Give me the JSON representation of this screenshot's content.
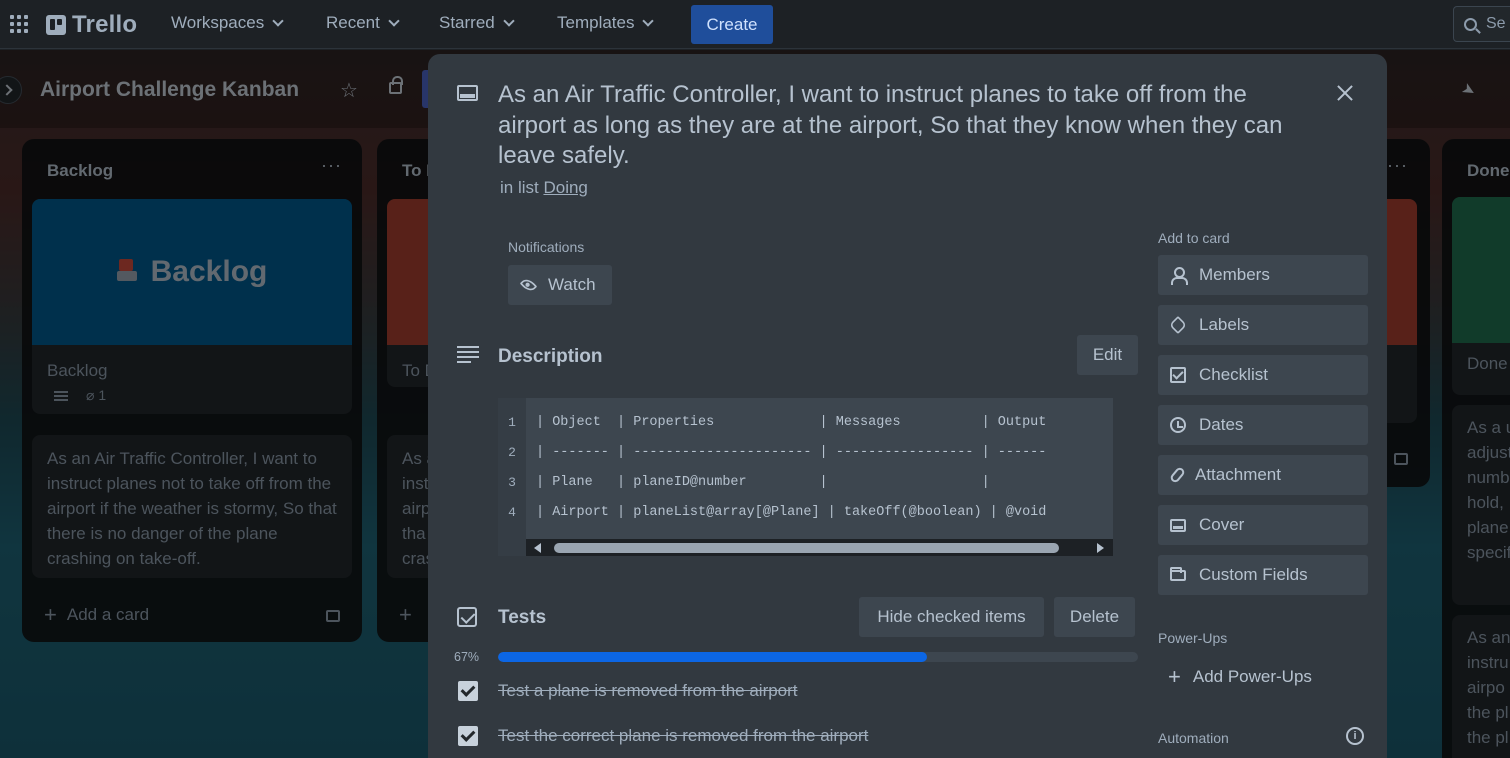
{
  "topnav": {
    "logo_text": "Trello",
    "menus": [
      "Workspaces",
      "Recent",
      "Starred",
      "Templates"
    ],
    "create_label": "Create",
    "search_placeholder": "Se"
  },
  "board": {
    "title": "Airport Challenge Kanban",
    "lists": [
      {
        "title": "Backlog",
        "cover_text": "Backlog",
        "card_title": "Backlog",
        "attachments": "1",
        "card2_text": "As an Air Traffic Controller, I want to instruct planes not to take off from the airport if the weather is stormy, So that there is no danger of the plane crashing on take-off.",
        "add_card": "Add a card"
      },
      {
        "title": "To D",
        "card_title": "To D",
        "card2_text": "As a\ninst\nairp\ntha\ncras",
        "add_card": "A"
      },
      {
        "title": "Done",
        "card_title": "Done",
        "card2_text": "As a u\nadjust\nnumb\nhold,\nplane\nspecif",
        "card3_text": "As an\ninstru\nairpo\nthe pl\nthe pl"
      }
    ]
  },
  "modal": {
    "title": "As an Air Traffic Controller, I want to instruct planes to take off from the airport as long as they are at the airport, So that they know when they can leave safely.",
    "in_list_prefix": "in list",
    "in_list_link": "Doing",
    "notifications_label": "Notifications",
    "watch_label": "Watch",
    "description_title": "Description",
    "edit_label": "Edit",
    "code_lines": [
      {
        "n": "1",
        "text": "| Object  | Properties             | Messages          | Output"
      },
      {
        "n": "2",
        "text": "| ------- | ---------------------- | ----------------- | ------"
      },
      {
        "n": "3",
        "text": "| Plane   | planeID@number         |                   |"
      },
      {
        "n": "4",
        "text": "| Airport | planeList@array[@Plane] | takeOff(@boolean) | @void"
      }
    ],
    "checklist": {
      "title": "Tests",
      "hide_label": "Hide checked items",
      "delete_label": "Delete",
      "percent_text": "67%",
      "progress": 0.67,
      "items": [
        {
          "text": "Test a plane is removed from the airport",
          "checked": true
        },
        {
          "text": "Test the correct plane is removed from the airport",
          "checked": true
        }
      ]
    },
    "sidebar": {
      "add_to_card_label": "Add to card",
      "buttons": [
        {
          "label": "Members",
          "icon": "person-icon"
        },
        {
          "label": "Labels",
          "icon": "tag-icon"
        },
        {
          "label": "Checklist",
          "icon": "checklist-icon"
        },
        {
          "label": "Dates",
          "icon": "clock-icon"
        },
        {
          "label": "Attachment",
          "icon": "paperclip-icon"
        },
        {
          "label": "Cover",
          "icon": "cover-icon"
        },
        {
          "label": "Custom Fields",
          "icon": "custom-fields-icon"
        }
      ],
      "powerups_label": "Power-Ups",
      "add_powerups_label": "Add Power-Ups",
      "automation_label": "Automation"
    }
  },
  "colors": {
    "modal_bg": "#323940",
    "accent": "#0c66e4",
    "create_button": "#1f4e9b",
    "backlog_cover": "#005a8c"
  }
}
